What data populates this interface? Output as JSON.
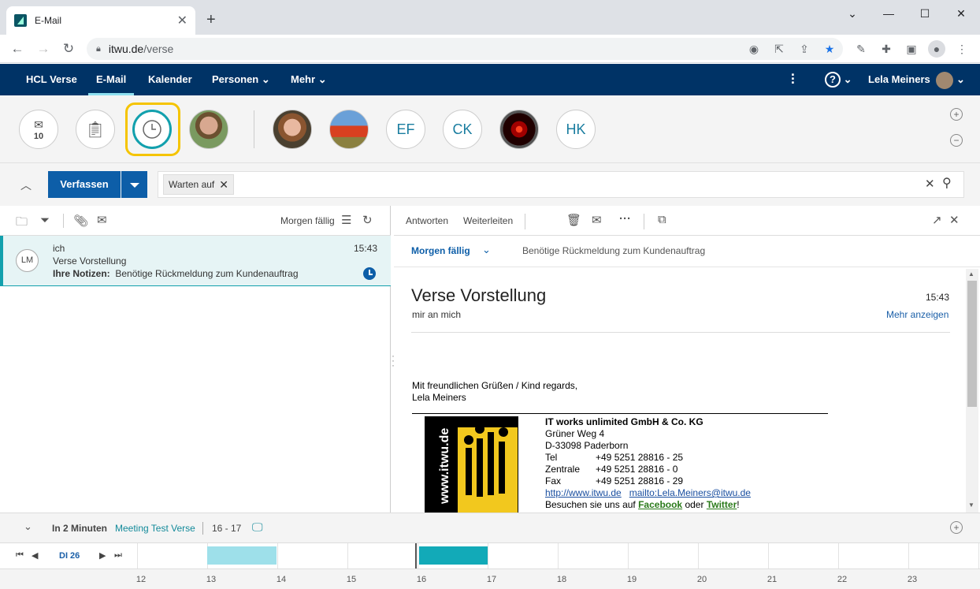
{
  "browser": {
    "tab_title": "E-Mail",
    "url_domain": "itwu.de",
    "url_path": "/verse"
  },
  "nav": {
    "brand": "HCL Verse",
    "items": [
      "E-Mail",
      "Kalender",
      "Personen",
      "Mehr"
    ],
    "user_name": "Lela Meiners"
  },
  "people_bar": {
    "inbox_count": "10",
    "initials": [
      "EF",
      "CK",
      "HK"
    ]
  },
  "compose": {
    "label": "Verfassen",
    "filter_chip": "Warten auf"
  },
  "list": {
    "sort_label": "Morgen fällig",
    "message": {
      "avatar": "LM",
      "sender": "ich",
      "time": "15:43",
      "subject": "Verse Vorstellung",
      "notes_label": "Ihre Notizen:",
      "notes_text": "Benötige Rückmeldung zum Kundenauftrag"
    }
  },
  "reading": {
    "reply": "Antworten",
    "forward": "Weiterleiten",
    "due_label": "Morgen fällig",
    "due_note": "Benötige Rückmeldung zum Kundenauftrag",
    "subject": "Verse Vorstellung",
    "time": "15:43",
    "recipients": "mir an mich",
    "more": "Mehr anzeigen",
    "greeting": "Mit freundlichen Grüßen / Kind regards,",
    "signer": "Lela Meiners",
    "logo_text": "www.itwu.de",
    "sig": {
      "company": "IT works unlimited GmbH & Co. KG",
      "street": "Grüner Weg 4",
      "city": "D-33098 Paderborn",
      "tel_label": "Tel",
      "tel": "+49 5251 28816 - 25",
      "central_label": "Zentrale",
      "central": "+49 5251 28816 - 0",
      "fax_label": "Fax",
      "fax": "+49 5251 28816 - 29",
      "web": "http://www.itwu.de",
      "mail": "mailto:Lela.Meiners@itwu.de",
      "visit_pre": "Besuchen sie uns auf",
      "facebook": "Facebook",
      "visit_mid": "oder",
      "twitter": "Twitter",
      "visit_end": "!"
    }
  },
  "event": {
    "when": "In 2 Minuten",
    "title": "Meeting Test Verse",
    "range": "16 - 17"
  },
  "timeline": {
    "day": "DI 26",
    "hours": [
      "12",
      "13",
      "14",
      "15",
      "16",
      "17",
      "18",
      "19",
      "20",
      "21",
      "22",
      "23"
    ]
  },
  "colors": {
    "nav_bg": "#003366",
    "accent": "#0d5ea8",
    "teal": "#12a0ad",
    "highlight": "#f5c400",
    "busy_light": "#9ee0ea",
    "busy_dark": "#12aab8"
  }
}
